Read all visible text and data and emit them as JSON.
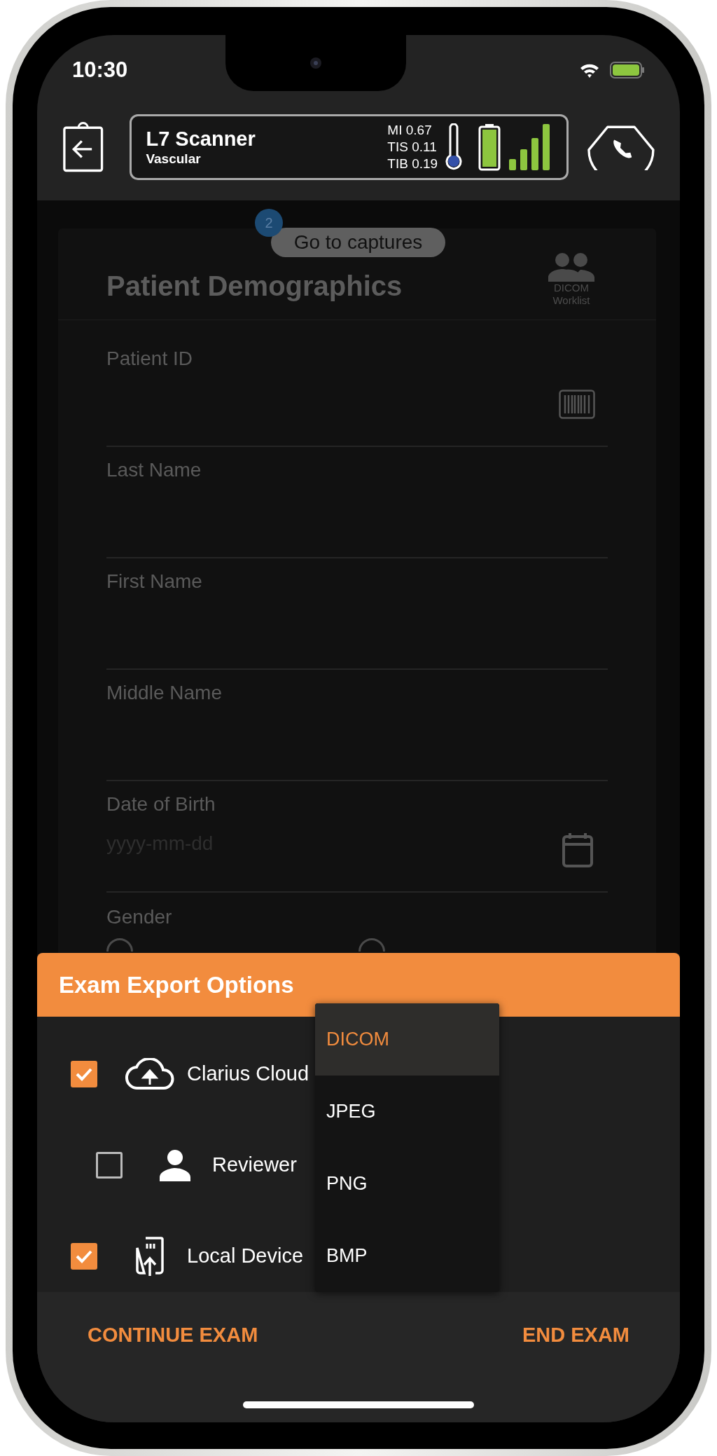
{
  "status_bar": {
    "time": "10:30"
  },
  "header": {
    "device": "L7 Scanner",
    "preset": "Vascular",
    "readings": [
      "MI 0.67",
      "TIS 0.11",
      "TIB 0.19"
    ]
  },
  "captures": {
    "count": "2",
    "label": "Go to captures"
  },
  "form": {
    "title": "Patient Demographics",
    "worklist": "DICOM Worklist",
    "fields": [
      {
        "label": "Patient ID",
        "kind": "barcode"
      },
      {
        "label": "Last Name",
        "kind": "text"
      },
      {
        "label": "First Name",
        "kind": "text"
      },
      {
        "label": "Middle Name",
        "kind": "text"
      },
      {
        "label": "Date of Birth",
        "kind": "date",
        "placeholder": "yyyy-mm-dd"
      }
    ],
    "gender": {
      "label": "Gender",
      "options": [
        {
          "selected": false
        },
        {
          "selected": false
        }
      ]
    }
  },
  "export": {
    "title": "Exam Export Options",
    "destinations": [
      {
        "label": "Clarius Cloud",
        "kind": "cloud",
        "checked": true,
        "children": [
          {
            "label": "Reviewer",
            "kind": "person",
            "checked": false
          }
        ]
      },
      {
        "label": "Local Device",
        "kind": "device",
        "checked": true
      }
    ],
    "format_menu": [
      {
        "label": "DICOM",
        "selected": true
      },
      {
        "label": "JPEG",
        "selected": false
      },
      {
        "label": "PNG",
        "selected": false
      },
      {
        "label": "BMP",
        "selected": false
      }
    ]
  },
  "actions": [
    "CONTINUE EXAM",
    "END EXAM"
  ]
}
